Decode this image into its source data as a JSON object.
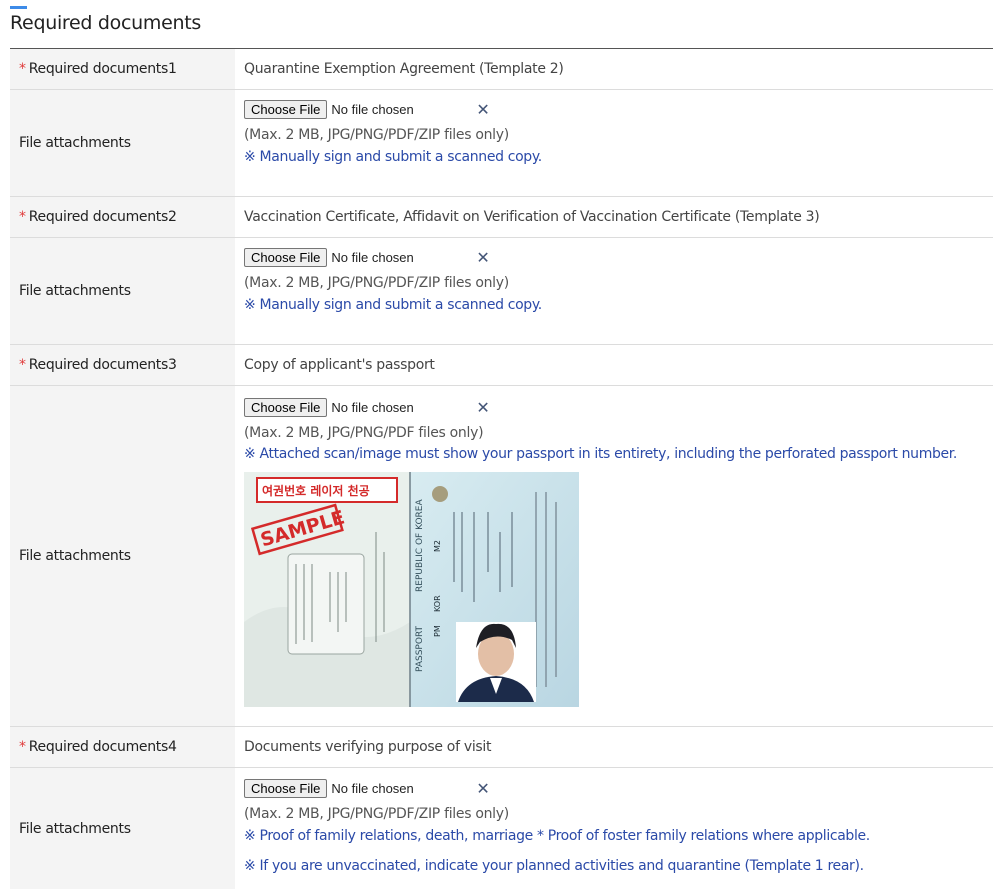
{
  "section": {
    "title": "Required documents"
  },
  "rows": [
    {
      "required_label": "Required documents1",
      "required_value": "Quarantine Exemption Agreement (Template 2)",
      "attach_label": "File attachments",
      "file_button": "Choose File",
      "file_status": "No file chosen",
      "file_hint": "(Max. 2 MB, JPG/PNG/PDF/ZIP files only)",
      "notes": [
        "※ Manually sign and submit a scanned copy."
      ]
    },
    {
      "required_label": "Required documents2",
      "required_value": "Vaccination Certificate, Affidavit on Verification of Vaccination Certificate (Template 3)",
      "attach_label": "File attachments",
      "file_button": "Choose File",
      "file_status": "No file chosen",
      "file_hint": "(Max. 2 MB, JPG/PNG/PDF/ZIP files only)",
      "notes": [
        "※ Manually sign and submit a scanned copy."
      ]
    },
    {
      "required_label": "Required documents3",
      "required_value": "Copy of applicant's passport",
      "attach_label": "File attachments",
      "file_button": "Choose File",
      "file_status": "No file chosen",
      "file_hint": "(Max. 2 MB, JPG/PNG/PDF files only)",
      "notes": [
        "※ Attached scan/image must show your passport in its entirety, including the perforated passport number."
      ],
      "sample_image": {
        "callout_text": "여권번호 레이저 천공",
        "stamp_text": "SAMPLE",
        "passport_word": "PASSPORT",
        "country_text": "REPUBLIC OF KOREA",
        "country_code": "KOR",
        "passport_type": "PM",
        "passport_no_prefix": "M2"
      }
    },
    {
      "required_label": "Required documents4",
      "required_value": "Documents verifying purpose of visit",
      "attach_label": "File attachments",
      "file_button": "Choose File",
      "file_status": "No file chosen",
      "file_hint": "(Max. 2 MB, JPG/PNG/PDF/ZIP files only)",
      "notes": [
        "※ Proof of family relations, death, marriage * Proof of foster family relations where applicable.",
        "※ If you are unvaccinated, indicate your planned activities and quarantine (Template 1 rear)."
      ]
    }
  ],
  "required_marker": "*",
  "remove_glyph": "✕",
  "colors": {
    "accent": "#3d8be8",
    "required_star": "#e03a3a",
    "note_text": "#2b4aa8",
    "label_bg": "#f4f4f4"
  }
}
